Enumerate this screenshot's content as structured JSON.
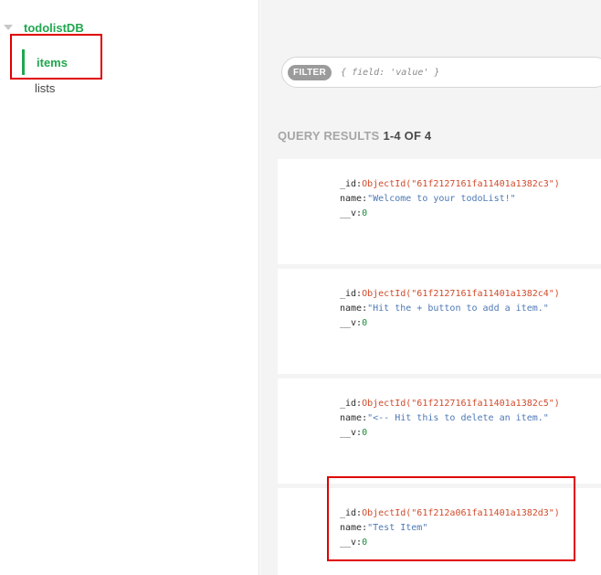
{
  "sidebar": {
    "database": "todolistDB",
    "collections": [
      {
        "label": "items",
        "active": true
      },
      {
        "label": "lists",
        "active": false
      }
    ]
  },
  "filter": {
    "badge": "FILTER",
    "placeholder": "{ field: 'value' }"
  },
  "results": {
    "label": "QUERY RESULTS",
    "count": "1-4 OF 4"
  },
  "documents": [
    {
      "id_key": "_id:",
      "id_value": "ObjectId(\"61f2127161fa11401a1382c3\")",
      "name_key": "name:",
      "name_value": "\"Welcome to your todoList!\"",
      "v_key": "__v:",
      "v_value": "0"
    },
    {
      "id_key": "_id:",
      "id_value": "ObjectId(\"61f2127161fa11401a1382c4\")",
      "name_key": "name:",
      "name_value": "\"Hit the + button to add a item.\"",
      "v_key": "__v:",
      "v_value": "0"
    },
    {
      "id_key": "_id:",
      "id_value": "ObjectId(\"61f2127161fa11401a1382c5\")",
      "name_key": "name:",
      "name_value": "\"<-- Hit this to delete an item.\"",
      "v_key": "__v:",
      "v_value": "0"
    },
    {
      "id_key": "_id:",
      "id_value": "ObjectId(\"61f212a061fa11401a1382d3\")",
      "name_key": "name:",
      "name_value": "\"Test Item\"",
      "v_key": "__v:",
      "v_value": "0"
    }
  ],
  "colors": {
    "accent_green": "#21a74f",
    "highlight_red": "#e00000",
    "objectid": "#d14a2a",
    "string": "#4d79b5"
  },
  "icons": {
    "db_caret": "caret-down-icon"
  }
}
